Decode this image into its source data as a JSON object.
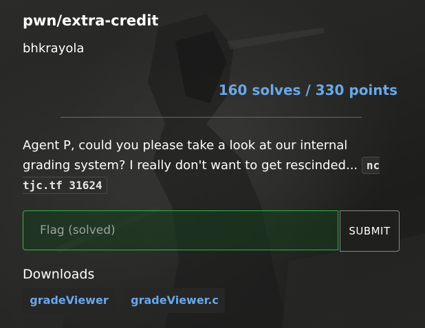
{
  "challenge": {
    "title": "pwn/extra-credit",
    "author": "bhkrayola",
    "stats": "160 solves / 330 points",
    "description_text": "Agent P, could you please take a look at our internal grading system? I really don't want to get rescinded... ",
    "description_code": "nc tjc.tf 31624"
  },
  "flag_form": {
    "placeholder": "Flag (solved)",
    "value": "",
    "submit_label": "SUBMIT"
  },
  "downloads": {
    "label": "Downloads",
    "files": [
      {
        "name": "gradeViewer"
      },
      {
        "name": "gradeViewer.c"
      }
    ]
  },
  "colors": {
    "accent": "#6aa8e8",
    "success_border": "#2fb84a",
    "background": "#242423"
  }
}
